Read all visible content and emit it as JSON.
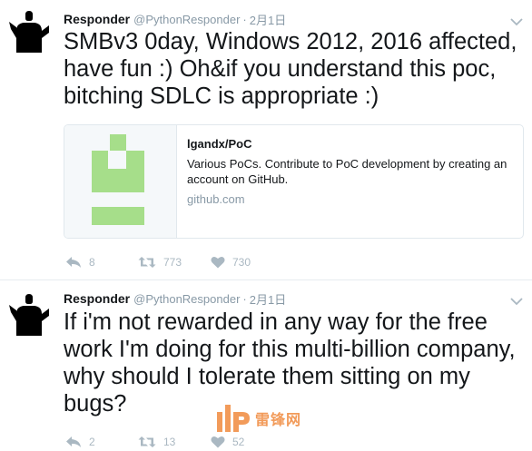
{
  "colors": {
    "text": "#14171a",
    "secondary": "#8899a6",
    "action_icon": "#aab8c2",
    "border": "#e1e8ed",
    "card_image_green": "#a6de8a",
    "watermark": "#f08a3e"
  },
  "tweets": [
    {
      "author_name": "Responder",
      "author_handle": "@PythonResponder",
      "separator": "·",
      "timestamp": "2月1日",
      "text": "SMBv3 0day, Windows 2012, 2016 affected, have fun :) Oh&if you understand this poc, bitching SDLC is appropriate :)",
      "card": {
        "title": "lgandx/PoC",
        "description": "Various PoCs. Contribute to PoC development by creating an account on GitHub.",
        "domain": "github.com",
        "image_icon": "github-repo-identicon"
      },
      "replies": "8",
      "retweets": "773",
      "likes": "730"
    },
    {
      "author_name": "Responder",
      "author_handle": "@PythonResponder",
      "separator": "·",
      "timestamp": "2月1日",
      "text": "If i'm not rewarded in any way for the free work I'm doing for this multi-billion company, why should I tolerate them sitting on my bugs?",
      "replies": "2",
      "retweets": "13",
      "likes": "52"
    }
  ],
  "watermark": {
    "text": "雷锋网",
    "icon": "leiphone-logo"
  }
}
